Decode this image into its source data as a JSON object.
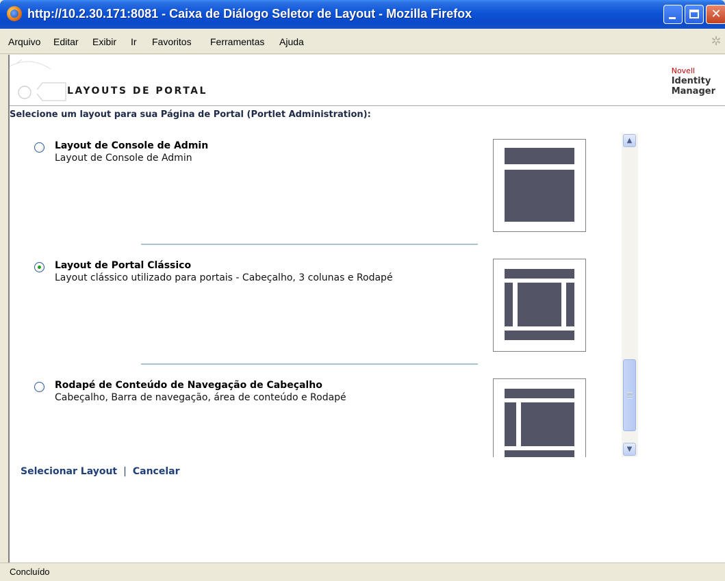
{
  "window": {
    "title": "http://10.2.30.171:8081 - Caixa de Diálogo Seletor de Layout - Mozilla Firefox",
    "min_glyph": "",
    "close_glyph": "✕"
  },
  "menu": {
    "items": [
      "Arquivo",
      "Editar",
      "Exibir",
      "Ir",
      "Favoritos",
      "Ferramentas",
      "Ajuda"
    ]
  },
  "banner": {
    "title": "LAYOUTS DE PORTAL",
    "brand_novell": "Novell",
    "brand_line1": "Identity",
    "brand_line2": "Manager"
  },
  "instruction": "Selecione um layout para sua Página de Portal (Portlet Administration):",
  "layouts": [
    {
      "title": "Layout de Console de Admin",
      "description": "Layout de Console de Admin",
      "selected": false
    },
    {
      "title": "Layout de Portal Clássico",
      "description": "Layout clássico utilizado para portais - Cabeçalho, 3 colunas e Rodapé",
      "selected": true
    },
    {
      "title": "Rodapé de Conteúdo de Navegação de Cabeçalho",
      "description": "Cabeçalho, Barra de navegação, área de conteúdo e Rodapé",
      "selected": false
    }
  ],
  "actions": {
    "select_label": "Selecionar Layout",
    "separator": "|",
    "cancel_label": "Cancelar"
  },
  "status": "Concluído",
  "colors": {
    "titlebar": "#0a49c9",
    "link": "#1f3f7a",
    "thumb_block": "#535566",
    "divider": "#a9c3d4",
    "brand_red": "#cc0000"
  }
}
